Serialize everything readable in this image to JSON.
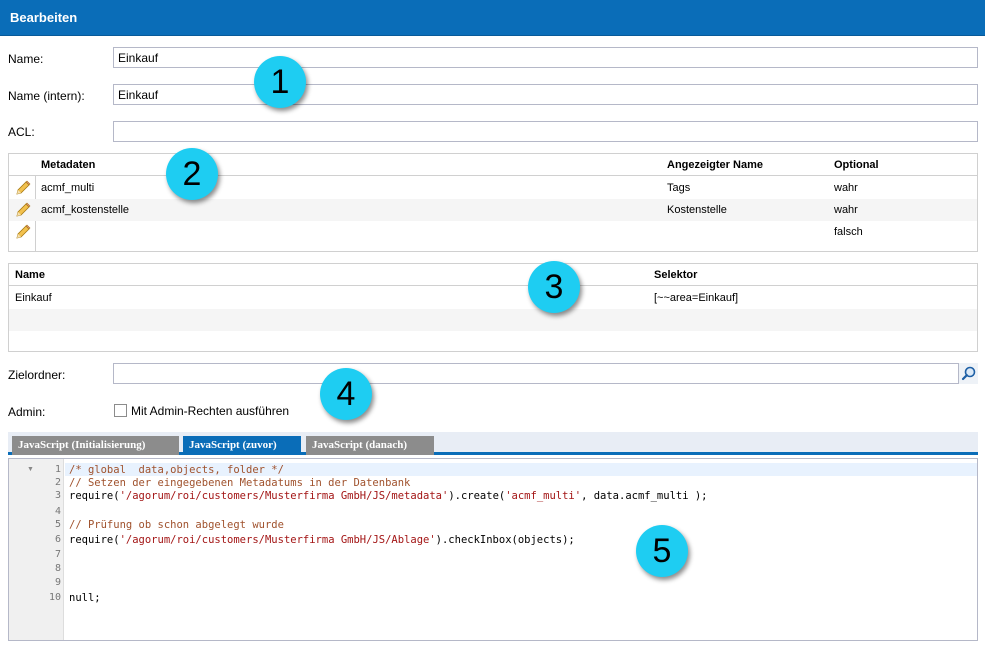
{
  "header": {
    "title": "Bearbeiten"
  },
  "form": {
    "name_label": "Name:",
    "name_value": "Einkauf",
    "name_intern_label": "Name (intern):",
    "name_intern_value": "Einkauf",
    "acl_label": "ACL:",
    "acl_value": "",
    "zielordner_label": "Zielordner:",
    "zielordner_value": "",
    "admin_label": "Admin:",
    "admin_checkbox_label": "Mit Admin-Rechten ausführen",
    "admin_checked": false
  },
  "metadata_grid": {
    "columns": [
      "Metadaten",
      "Angezeigter Name",
      "Optional"
    ],
    "rows": [
      {
        "metadaten": "acmf_multi",
        "angezeigter_name": "Tags",
        "optional": "wahr"
      },
      {
        "metadaten": "acmf_kostenstelle",
        "angezeigter_name": "Kostenstelle",
        "optional": "wahr"
      },
      {
        "metadaten": "",
        "angezeigter_name": "",
        "optional": "falsch"
      }
    ]
  },
  "selector_grid": {
    "columns": [
      "Name",
      "Selektor"
    ],
    "rows": [
      {
        "name": "Einkauf",
        "selektor": "[~~area=Einkauf]"
      }
    ]
  },
  "tabs": [
    {
      "label": "JavaScript (Initialisierung)",
      "active": false
    },
    {
      "label": "JavaScript (zuvor)",
      "active": true
    },
    {
      "label": "JavaScript (danach)",
      "active": false
    }
  ],
  "editor": {
    "line_numbers": [
      "1",
      "2",
      "3",
      "4",
      "5",
      "6",
      "7",
      "8",
      "9",
      "10"
    ],
    "lines": {
      "l1": "/* global  data,objects, folder */",
      "l2": "// Setzen der eingegebenen Metadatums in der Datenbank",
      "l3_a": "require(",
      "l3_s1": "'/agorum/roi/customers/Musterfirma GmbH/JS/metadata'",
      "l3_b": ").create(",
      "l3_s2": "'acmf_multi'",
      "l3_c": ", data.acmf_multi );",
      "l5": "// Prüfung ob schon abgelegt wurde",
      "l6_a": "require(",
      "l6_s1": "'/agorum/roi/customers/Musterfirma GmbH/JS/Ablage'",
      "l6_b": ").checkInbox(objects);",
      "l10": "null;"
    }
  },
  "callouts": [
    "1",
    "2",
    "3",
    "4",
    "5"
  ],
  "colors": {
    "header_blue": "#0a6db8",
    "callout_cyan": "#1ecdf2",
    "tab_inactive": "#8c8c8c",
    "comment": "#a0522d",
    "string": "#a31515"
  },
  "icons": {
    "edit": "pencil-icon",
    "search": "magnifier-icon",
    "fold": "fold-arrow-icon"
  }
}
